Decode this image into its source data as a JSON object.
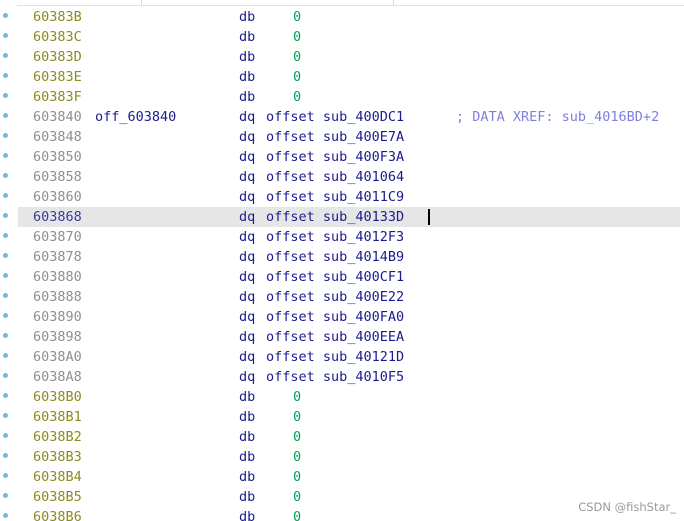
{
  "colors": {
    "address_olive": "#8a8a1e",
    "address_gray": "#8f8f8f",
    "keyword_blue": "#1b1b8f",
    "number_green": "#00a05a",
    "comment_purple": "#8080d8",
    "selection_bg": "#e6e6e6",
    "breakpoint_dot": "#6fb8e3"
  },
  "rows": [
    {
      "addr": "60383B",
      "label": "",
      "mnem": "db",
      "operand": "0",
      "kind": "db",
      "addr_style": "olive"
    },
    {
      "addr": "60383C",
      "label": "",
      "mnem": "db",
      "operand": "0",
      "kind": "db",
      "addr_style": "olive"
    },
    {
      "addr": "60383D",
      "label": "",
      "mnem": "db",
      "operand": "0",
      "kind": "db",
      "addr_style": "olive"
    },
    {
      "addr": "60383E",
      "label": "",
      "mnem": "db",
      "operand": "0",
      "kind": "db",
      "addr_style": "olive"
    },
    {
      "addr": "60383F",
      "label": "",
      "mnem": "db",
      "operand": "0",
      "kind": "db",
      "addr_style": "olive"
    },
    {
      "addr": "603840",
      "label": "off_603840",
      "mnem": "dq",
      "operand": "offset sub_400DC1",
      "kind": "dq",
      "addr_style": "gray",
      "comment": "; DATA XREF: sub_4016BD+2"
    },
    {
      "addr": "603848",
      "label": "",
      "mnem": "dq",
      "operand": "offset sub_400E7A",
      "kind": "dq",
      "addr_style": "gray"
    },
    {
      "addr": "603850",
      "label": "",
      "mnem": "dq",
      "operand": "offset sub_400F3A",
      "kind": "dq",
      "addr_style": "gray"
    },
    {
      "addr": "603858",
      "label": "",
      "mnem": "dq",
      "operand": "offset sub_401064",
      "kind": "dq",
      "addr_style": "gray"
    },
    {
      "addr": "603860",
      "label": "",
      "mnem": "dq",
      "operand": "offset sub_4011C9",
      "kind": "dq",
      "addr_style": "gray"
    },
    {
      "addr": "603868",
      "label": "",
      "mnem": "dq",
      "operand": "offset sub_40133D",
      "kind": "dq",
      "addr_style": "gray",
      "current": true
    },
    {
      "addr": "603870",
      "label": "",
      "mnem": "dq",
      "operand": "offset sub_4012F3",
      "kind": "dq",
      "addr_style": "gray"
    },
    {
      "addr": "603878",
      "label": "",
      "mnem": "dq",
      "operand": "offset sub_4014B9",
      "kind": "dq",
      "addr_style": "gray"
    },
    {
      "addr": "603880",
      "label": "",
      "mnem": "dq",
      "operand": "offset sub_400CF1",
      "kind": "dq",
      "addr_style": "gray"
    },
    {
      "addr": "603888",
      "label": "",
      "mnem": "dq",
      "operand": "offset sub_400E22",
      "kind": "dq",
      "addr_style": "gray"
    },
    {
      "addr": "603890",
      "label": "",
      "mnem": "dq",
      "operand": "offset sub_400FA0",
      "kind": "dq",
      "addr_style": "gray"
    },
    {
      "addr": "603898",
      "label": "",
      "mnem": "dq",
      "operand": "offset sub_400EEA",
      "kind": "dq",
      "addr_style": "gray"
    },
    {
      "addr": "6038A0",
      "label": "",
      "mnem": "dq",
      "operand": "offset sub_40121D",
      "kind": "dq",
      "addr_style": "gray"
    },
    {
      "addr": "6038A8",
      "label": "",
      "mnem": "dq",
      "operand": "offset sub_4010F5",
      "kind": "dq",
      "addr_style": "gray"
    },
    {
      "addr": "6038B0",
      "label": "",
      "mnem": "db",
      "operand": "0",
      "kind": "db",
      "addr_style": "olive"
    },
    {
      "addr": "6038B1",
      "label": "",
      "mnem": "db",
      "operand": "0",
      "kind": "db",
      "addr_style": "olive"
    },
    {
      "addr": "6038B2",
      "label": "",
      "mnem": "db",
      "operand": "0",
      "kind": "db",
      "addr_style": "olive"
    },
    {
      "addr": "6038B3",
      "label": "",
      "mnem": "db",
      "operand": "0",
      "kind": "db",
      "addr_style": "olive"
    },
    {
      "addr": "6038B4",
      "label": "",
      "mnem": "db",
      "operand": "0",
      "kind": "db",
      "addr_style": "olive"
    },
    {
      "addr": "6038B5",
      "label": "",
      "mnem": "db",
      "operand": "0",
      "kind": "db",
      "addr_style": "olive"
    },
    {
      "addr": "6038B6",
      "label": "",
      "mnem": "db",
      "operand": "0",
      "kind": "db",
      "addr_style": "olive"
    }
  ],
  "watermark": "CSDN @fishStar_"
}
